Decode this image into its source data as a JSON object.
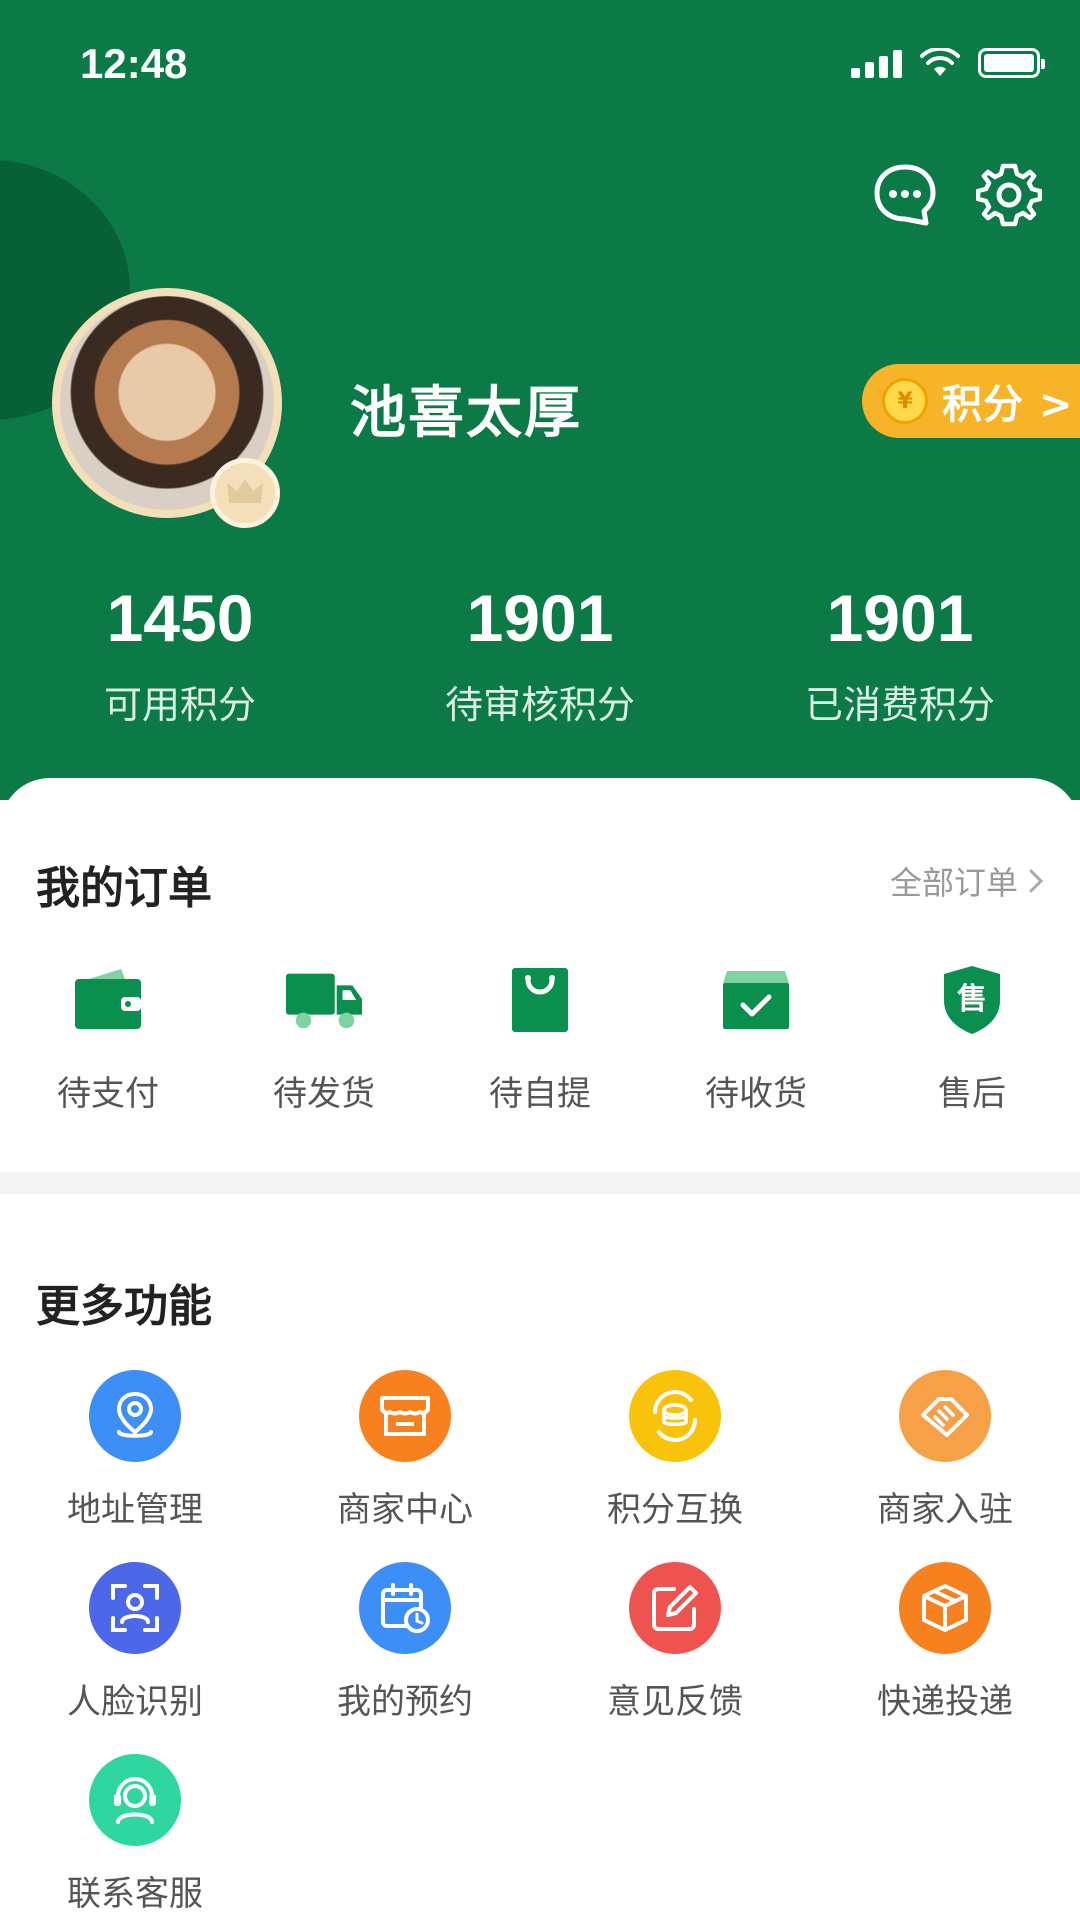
{
  "status_bar": {
    "time": "12:48"
  },
  "profile": {
    "name": "池喜太厚",
    "points_button": "积分 >",
    "coin_symbol": "¥"
  },
  "stats": [
    {
      "value": "1450",
      "label": "可用积分"
    },
    {
      "value": "1901",
      "label": "待审核积分"
    },
    {
      "value": "1901",
      "label": "已消费积分"
    }
  ],
  "orders": {
    "title": "我的订单",
    "all_link": "全部订单",
    "items": [
      {
        "label": "待支付",
        "icon": "wallet-icon"
      },
      {
        "label": "待发货",
        "icon": "truck-icon"
      },
      {
        "label": "待自提",
        "icon": "shopping-bag-icon"
      },
      {
        "label": "待收货",
        "icon": "box-check-icon"
      },
      {
        "label": "售后",
        "icon": "shield-service-icon",
        "badge": "售"
      }
    ]
  },
  "features": {
    "title": "更多功能",
    "items": [
      {
        "label": "地址管理",
        "icon": "location-pin-icon",
        "color": "#3d8ef7"
      },
      {
        "label": "商家中心",
        "icon": "store-icon",
        "color": "#f7801f"
      },
      {
        "label": "积分互换",
        "icon": "coin-exchange-icon",
        "color": "#f9c30c"
      },
      {
        "label": "商家入驻",
        "icon": "handshake-icon",
        "color": "#f6a147"
      },
      {
        "label": "人脸识别",
        "icon": "face-id-icon",
        "color": "#4c67e8"
      },
      {
        "label": "我的预约",
        "icon": "calendar-clock-icon",
        "color": "#3d8ef7"
      },
      {
        "label": "意见反馈",
        "icon": "edit-icon",
        "color": "#ef5350"
      },
      {
        "label": "快递投递",
        "icon": "package-icon",
        "color": "#f7801f"
      },
      {
        "label": "联系客服",
        "icon": "headset-icon",
        "color": "#2fd6a0"
      }
    ]
  },
  "colors": {
    "brand_green": "#0b7a47",
    "points_orange": "#f7b428"
  }
}
